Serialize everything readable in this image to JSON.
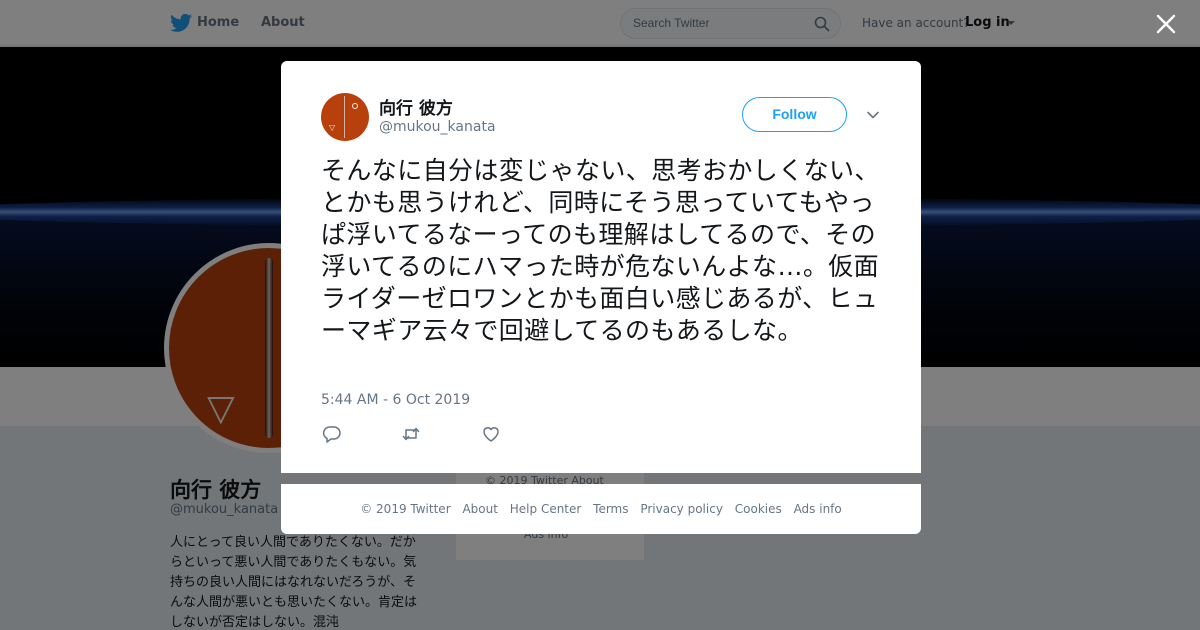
{
  "topnav": {
    "home_label": "Home",
    "about_label": "About",
    "search_placeholder": "Search Twitter",
    "have_account": "Have an account?",
    "login_label": "Log in"
  },
  "profile": {
    "name": "向行 彼方",
    "handle": "@mukou_kanata",
    "bio": "人にとって良い人間でありたくない。だからといって悪い人間でありたくもない。気持ちの良い人間にはなれないだろうが、そんな人間が悪いとも思いたくない。肯定はしないが否定はしない。混沌"
  },
  "sidebar_footer": {
    "copyright": "© 2019 Twitter   About",
    "ads_info": "Ads info"
  },
  "tweet": {
    "author_name": "向行 彼方",
    "author_handle": "@mukou_kanata",
    "follow_label": "Follow",
    "text": "そんなに自分は変じゃない、思考おかしくない、とかも思うけれど、同時にそう思っていてもやっぱ浮いてるなーってのも理解はしてるので、その浮いてるのにハマった時が危ないんよな…。仮面ライダーゼロワンとかも面白い感じあるが、ヒューマギア云々で回避してるのもあるしな。",
    "timestamp": "5:44 AM - 6 Oct 2019"
  },
  "footer": {
    "links": [
      "© 2019 Twitter",
      "About",
      "Help Center",
      "Terms",
      "Privacy policy",
      "Cookies",
      "Ads info"
    ]
  },
  "colors": {
    "accent": "#1da1f2",
    "secondary_text": "#657786",
    "avatar_bg": "#b7400c"
  },
  "icons": {
    "logo": "twitter-bird-icon",
    "search": "search-icon",
    "close": "close-icon",
    "more": "chevron-down-icon",
    "reply": "reply-icon",
    "retweet": "retweet-icon",
    "like": "heart-icon"
  }
}
